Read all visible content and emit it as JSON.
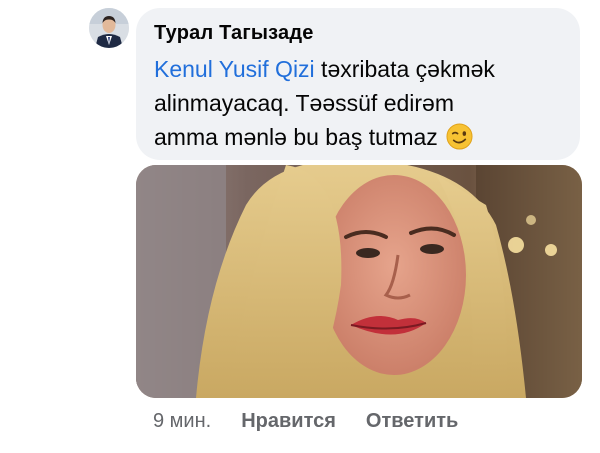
{
  "comment": {
    "author": "Турал Тагызаде",
    "mention": "Kenul Yusif Qizi",
    "text_line1": " təxribata çəkmək",
    "text_line2": "alinmayacaq. Təəssüf edirəm",
    "text_line3": "amma mənlə bu baş tutmaz",
    "emoji": "winking-face-icon",
    "photo": "woman-blonde-hair-photo",
    "avatar": "man-in-suit-avatar"
  },
  "actions": {
    "time": "9 мин.",
    "like": "Нравится",
    "reply": "Ответить"
  },
  "colors": {
    "bubble": "#f0f2f5",
    "mention": "#216fdb",
    "meta": "#65676b",
    "text": "#050505"
  }
}
